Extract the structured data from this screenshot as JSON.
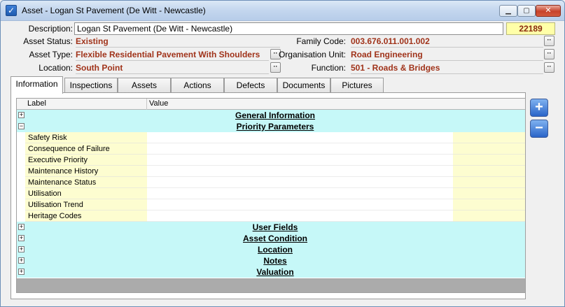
{
  "window": {
    "title": "Asset - Logan St Pavement (De Witt - Newcastle)",
    "controls": {
      "minimize": "▁",
      "maximize": "▢",
      "close": "✕"
    }
  },
  "header": {
    "description_label": "Description:",
    "description_value": "Logan St Pavement (De Witt - Newcastle)",
    "asset_id": "22189",
    "asset_status_label": "Asset Status:",
    "asset_status_value": "Existing",
    "family_code_label": "Family Code:",
    "family_code_value": "003.676.011.001.002",
    "asset_type_label": "Asset Type:",
    "asset_type_value": "Flexible Residential Pavement With Shoulders",
    "org_unit_label": "Organisation Unit:",
    "org_unit_value": "Road Engineering",
    "location_label": "Location:",
    "location_value": "South Point",
    "function_label": "Function:",
    "function_value": "501 - Roads & Bridges",
    "lookup_label": "··"
  },
  "tabs": [
    "Information",
    "Inspections",
    "Assets",
    "Actions",
    "Defects",
    "Documents",
    "Pictures"
  ],
  "grid": {
    "columns": {
      "label": "Label",
      "value": "Value"
    },
    "expand_symbol": "+",
    "collapse_symbol": "−",
    "groups_top": [
      "General Information",
      "Priority Parameters"
    ],
    "priority_items": [
      "Safety Risk",
      "Consequence of Failure",
      "Executive Priority",
      "Maintenance History",
      "Maintenance Status",
      "Utilisation",
      "Utilisation Trend",
      "Heritage Codes"
    ],
    "groups_bottom": [
      "User Fields",
      "Asset Condition",
      "Location",
      "Notes",
      "Valuation"
    ]
  },
  "side_buttons": {
    "add": "+",
    "remove": "−"
  },
  "colors": {
    "group_row": "#c6f8f8",
    "label_cell": "#fdfdd0",
    "value_text": "#a0331a",
    "id_box": "#ffffa8"
  }
}
